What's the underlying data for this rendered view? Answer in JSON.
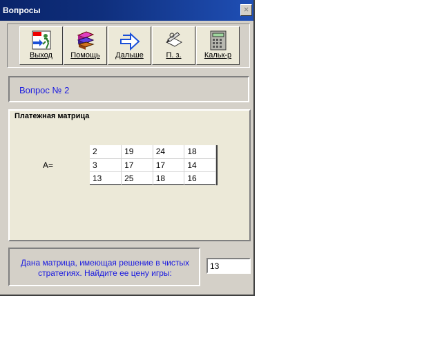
{
  "window": {
    "title": "Вопросы",
    "close_glyph": "×"
  },
  "toolbar": {
    "buttons": [
      {
        "label": "Выход",
        "icon": "exit-icon"
      },
      {
        "label": "Помощь",
        "icon": "books-icon"
      },
      {
        "label": "Дальше",
        "icon": "arrow-right-icon"
      },
      {
        "label": "П. з.",
        "icon": "notepad-pen-icon"
      },
      {
        "label": "Кальк-р",
        "icon": "calculator-icon"
      }
    ]
  },
  "question": {
    "title": "Вопрос № 2"
  },
  "matrix_group": {
    "title": "Платежная матрица",
    "label": "A=",
    "rows": [
      [
        "2",
        "19",
        "24",
        "18"
      ],
      [
        "3",
        "17",
        "17",
        "14"
      ],
      [
        "13",
        "25",
        "18",
        "16"
      ]
    ]
  },
  "prompt": {
    "text": "Дана матрица, имеющая решение в чистых стратегиях. Найдите ее цену игры:"
  },
  "answer": {
    "value": "13"
  },
  "colors": {
    "title_bar": "#0a246a",
    "question_text": "#1a1ae0",
    "panel": "#ece9d8",
    "window": "#d4d0c8"
  }
}
